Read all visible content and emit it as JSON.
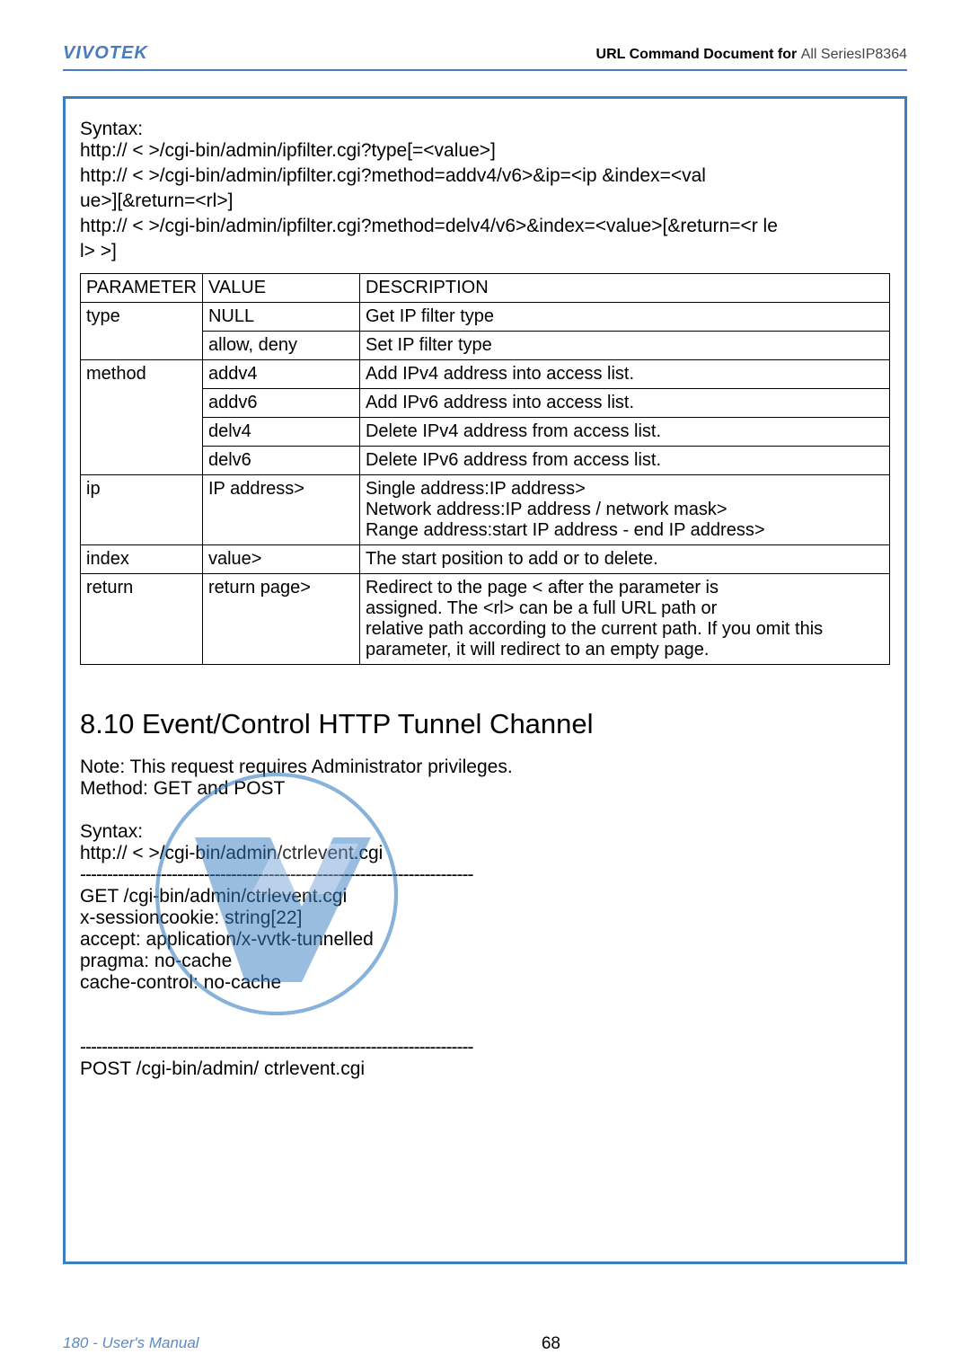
{
  "header": {
    "brand": "VIVOTEK",
    "title_bold": "URL Command Document for",
    "title_light": "All SeriesIP8364"
  },
  "syntax": {
    "label": "Syntax:",
    "lines": [
      "http:// <   >/cgi-bin/admin/ipfilter.cgi?type[=<value>]",
      "http:// <   >/cgi-bin/admin/ipfilter.cgi?method=addv4/v6>&ip=<ip          &index=<val",
      "ue>][&return=<rl>]",
      "http:// <   >/cgi-bin/admin/ipfilter.cgi?method=delv4/v6>&index=<value>[&return=<r      le",
      "l>    >]"
    ]
  },
  "table": {
    "headers": [
      "PARAMETER",
      "VALUE",
      "DESCRIPTION"
    ],
    "rows": [
      {
        "p": "type",
        "cells": [
          [
            "NULL",
            "Get IP filter type"
          ],
          [
            "allow, deny",
            " Set IP filter type"
          ]
        ]
      },
      {
        "p": "method",
        "cells": [
          [
            " addv4",
            "Add IPv4 address into access list."
          ],
          [
            "addv6",
            "Add IPv6 address into access list."
          ],
          [
            "delv4",
            "Delete IPv4 address from access list."
          ],
          [
            "delv6",
            "Delete IPv6 address from access list."
          ]
        ]
      },
      {
        "p": "ip",
        "cells": [
          [
            "IP address>",
            "Single address:IP address>\nNetwork address:IP address / network mask>\nRange address:start IP address - end IP address>"
          ]
        ]
      },
      {
        "p": "index",
        "cells": [
          [
            "value>",
            "The start position to add or to delete."
          ]
        ]
      },
      {
        "p": "return",
        "cells": [
          [
            "return page>",
            " Redirect to the page <        after the parameter is\nassigned. The <rl>           can be a full URL path or\nrelative path according to the current path. If you omit this\nparameter, it will redirect to an empty page."
          ]
        ]
      }
    ]
  },
  "section": {
    "heading": "8.10 Event/Control HTTP Tunnel Channel",
    "note": "Note: This request requires Administrator privileges.",
    "method": "Method: GET and POST",
    "syntax_label": "Syntax:",
    "line_url": "http:// <          >/cgi-bin/admin/ctrlevent.cgi",
    "dash": "-------------------------------------------------------------------------",
    "get_block": "GET /cgi-bin/admin/ctrlevent.cgi\nx-sessioncookie: string[22]\naccept: application/x-vvtk-tunnelled\npragma: no-cache\ncache-control: no-cache",
    "post_block": "POST /cgi-bin/admin/ ctrlevent.cgi"
  },
  "footer": {
    "left": "180 - User's Manual",
    "center": "68"
  }
}
